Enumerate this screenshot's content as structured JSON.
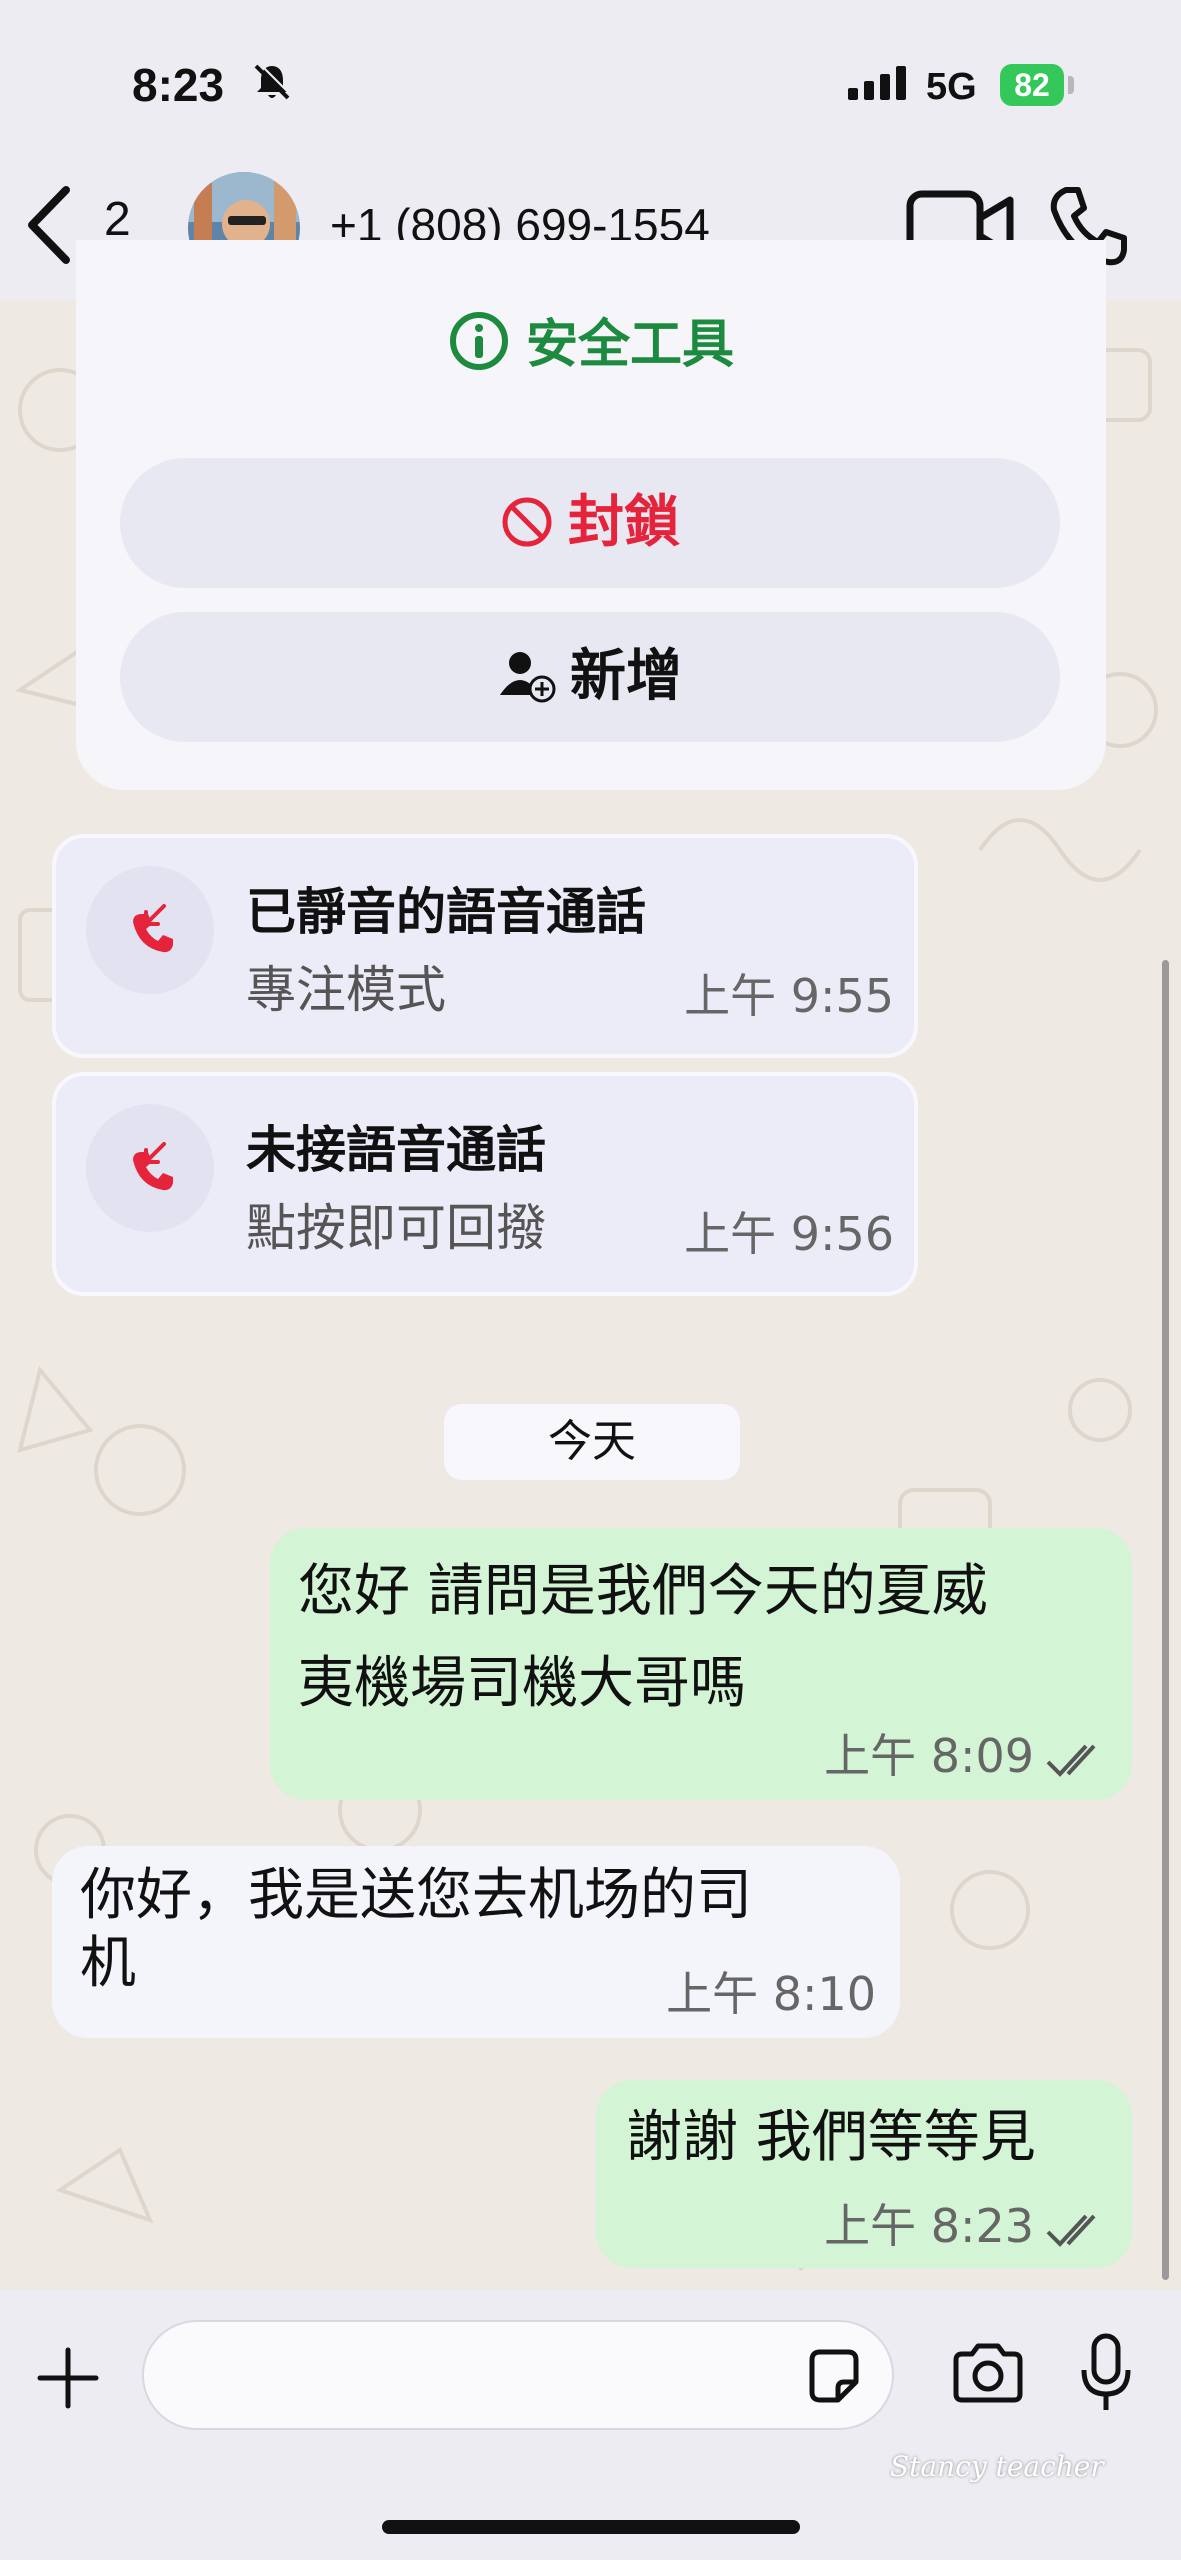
{
  "status_bar": {
    "time": "8:23",
    "network": "5G",
    "battery": "82"
  },
  "header": {
    "back_count": "2",
    "contact": "+1 (808) 699-1554"
  },
  "safety": {
    "title": "安全工具",
    "block_label": "封鎖",
    "add_label": "新增"
  },
  "calls": [
    {
      "title": "已靜音的語音通話",
      "subtitle": "專注模式",
      "time": "上午 9:55"
    },
    {
      "title": "未接語音通話",
      "subtitle": "點按即可回撥",
      "time": "上午 9:56"
    }
  ],
  "date_chip": "今天",
  "messages": [
    {
      "direction": "out",
      "line1": "您好 請問是我們今天的夏威",
      "line2": "夷機場司機大哥嗎",
      "time": "上午 8:09"
    },
    {
      "direction": "in",
      "line1": "你好，我是送您去机场的司",
      "line2": "机",
      "time": "上午 8:10"
    },
    {
      "direction": "out",
      "line1": "謝謝 我們等等見",
      "time": "上午 8:23"
    }
  ],
  "watermark": "Stancy teacher",
  "colors": {
    "outgoing_bubble": "#d3f4d5",
    "incoming_bubble": "#f4f4fb",
    "safety_green": "#1c8a3f",
    "block_red": "#e5243b",
    "call_icon_red": "#e5243b"
  },
  "icons": [
    "back-chevron-icon",
    "video-call-icon",
    "phone-icon",
    "info-icon",
    "block-icon",
    "add-contact-icon",
    "missed-call-icon",
    "plus-icon",
    "sticker-icon",
    "camera-icon",
    "microphone-icon"
  ]
}
